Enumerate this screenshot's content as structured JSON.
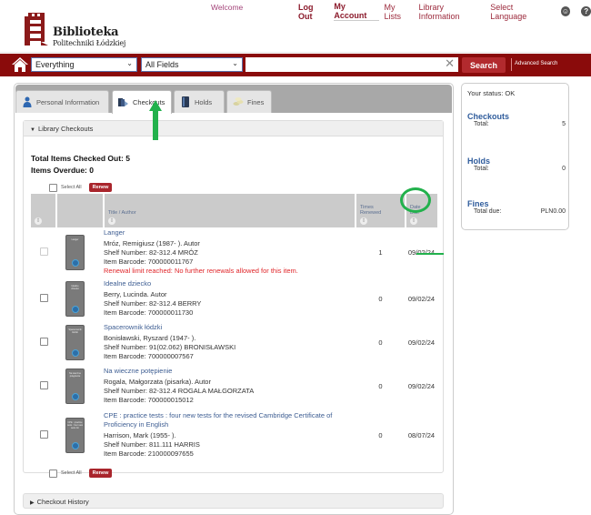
{
  "header": {
    "logo": {
      "title": "Biblioteka",
      "subtitle": "Politechniki Łódzkiej"
    },
    "welcome": "Welcome",
    "nav": {
      "log_out": "Log Out",
      "my_account": "My Account",
      "my_lists": "My Lists",
      "library_information": "Library Information",
      "select_language": "Select Language"
    },
    "icons": {
      "accessibility": "accessibility-icon",
      "help": "help-icon"
    }
  },
  "search": {
    "scope_value": "Everything",
    "field_value": "All Fields",
    "query_value": "",
    "search_label": "Search",
    "advanced_label": "Advanced Search",
    "clear_glyph": "✕"
  },
  "tabs": [
    {
      "label": "Personal Information",
      "icon": "person-icon",
      "active": false
    },
    {
      "label": "Checkouts",
      "icon": "checkout-books-icon",
      "active": true
    },
    {
      "label": "Holds",
      "icon": "book-icon",
      "active": false
    },
    {
      "label": "Fines",
      "icon": "coins-icon",
      "active": false
    }
  ],
  "checkouts_section": {
    "title": "Library Checkouts",
    "total_checked_out": "Total Items Checked Out: 5",
    "items_overdue": "Items Overdue: 0",
    "select_all_label": "Select All",
    "renew_label": "Renew",
    "columns": {
      "title_author": "Title / Author",
      "times_renewed_1": "Times",
      "times_renewed_2": "Renewed",
      "date_due_1": "Date",
      "date_due_2": "Due"
    },
    "items": [
      {
        "title": "Langer",
        "cover_text": "Langer",
        "author": "Mróz, Remigiusz (1987- ). Autor",
        "shelf": "Shelf Number: 82-312.4 MRÓZ",
        "barcode": "Item Barcode: 700000011767",
        "warning": "Renewal limit reached: No further renewals allowed for this item.",
        "times_renewed": "1",
        "date_due": "09/02/24",
        "renewable": false
      },
      {
        "title": "Idealne dziecko",
        "cover_text": "Idealne dziecko",
        "author": "Berry, Lucinda. Autor",
        "shelf": "Shelf Number: 82-312.4 BERRY",
        "barcode": "Item Barcode: 700000011730",
        "warning": "",
        "times_renewed": "0",
        "date_due": "09/02/24",
        "renewable": true
      },
      {
        "title": "Spacerownik łódzki",
        "cover_text": "Spacerownik łódzki",
        "author": "Bonisławski, Ryszard (1947- ).",
        "shelf": "Shelf Number: 91(02.062) BRONISŁAWSKI",
        "barcode": "Item Barcode: 700000007567",
        "warning": "",
        "times_renewed": "0",
        "date_due": "09/02/24",
        "renewable": true
      },
      {
        "title": "Na wieczne potępienie",
        "cover_text": "Na wieczne potępienie",
        "author": "Rogala, Małgorzata (pisarka). Autor",
        "shelf": "Shelf Number: 82-312.4 ROGALA MAŁGORZATA",
        "barcode": "Item Barcode: 700000015012",
        "warning": "",
        "times_renewed": "0",
        "date_due": "09/02/24",
        "renewable": true
      },
      {
        "title": "CPE : practice tests : four new tests for the revised Cambridge Certificate of Proficiency in English",
        "cover_text": "CPE : practice tests : four new tests for",
        "author": "Harrison, Mark (1955- ).",
        "shelf": "Shelf Number: 811.111 HARRIS",
        "barcode": "Item Barcode: 210000097655",
        "warning": "",
        "times_renewed": "0",
        "date_due": "08/07/24",
        "renewable": true
      }
    ]
  },
  "history_section": {
    "title": "Checkout History"
  },
  "status_box": {
    "status_line": "Your status: OK",
    "checkouts": {
      "title": "Checkouts",
      "label": "Total:",
      "value": "5"
    },
    "holds": {
      "title": "Holds",
      "label": "Total:",
      "value": "0"
    },
    "fines": {
      "title": "Fines",
      "label": "Total due:",
      "value": "PLN0.00"
    }
  },
  "colors": {
    "brand_dark_red": "#8a0b0b",
    "button_red": "#b22a2e",
    "link_blue": "#3d5d92",
    "warning_red": "#e0262a",
    "annotation_green": "#22b14c"
  }
}
